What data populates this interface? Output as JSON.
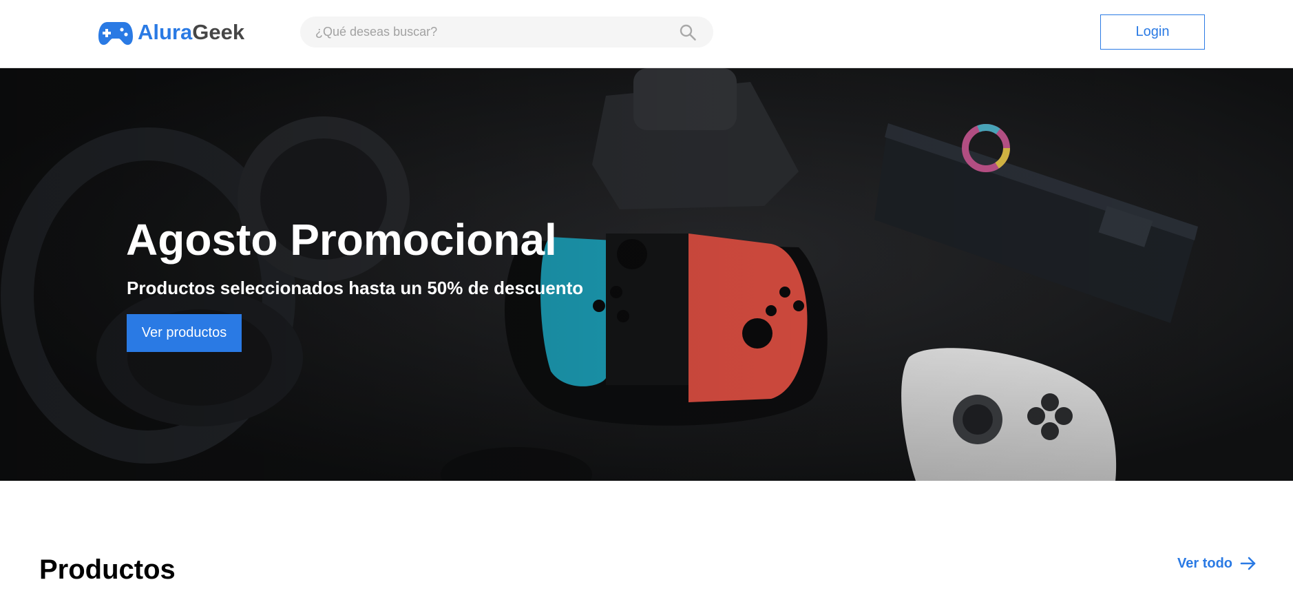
{
  "header": {
    "logo": {
      "text_part_a": "Alura",
      "text_part_b": "Geek",
      "icon": "gamepad-icon"
    },
    "search": {
      "placeholder": "¿Qué deseas buscar?",
      "value": "",
      "icon": "search-icon"
    },
    "login_label": "Login"
  },
  "hero": {
    "title": "Agosto Promocional",
    "subtitle": "Productos seleccionados hasta un 50% de descuento",
    "button_label": "Ver productos",
    "background": "dark photo of gaming accessories"
  },
  "products_section": {
    "title": "Productos",
    "see_all_label": "Ver todo",
    "see_all_icon": "arrow-right-icon"
  },
  "colors": {
    "accent": "#2a7ae4",
    "logo_dark": "#464646",
    "search_bg": "#f5f5f5",
    "hero_bg": "#141516"
  }
}
